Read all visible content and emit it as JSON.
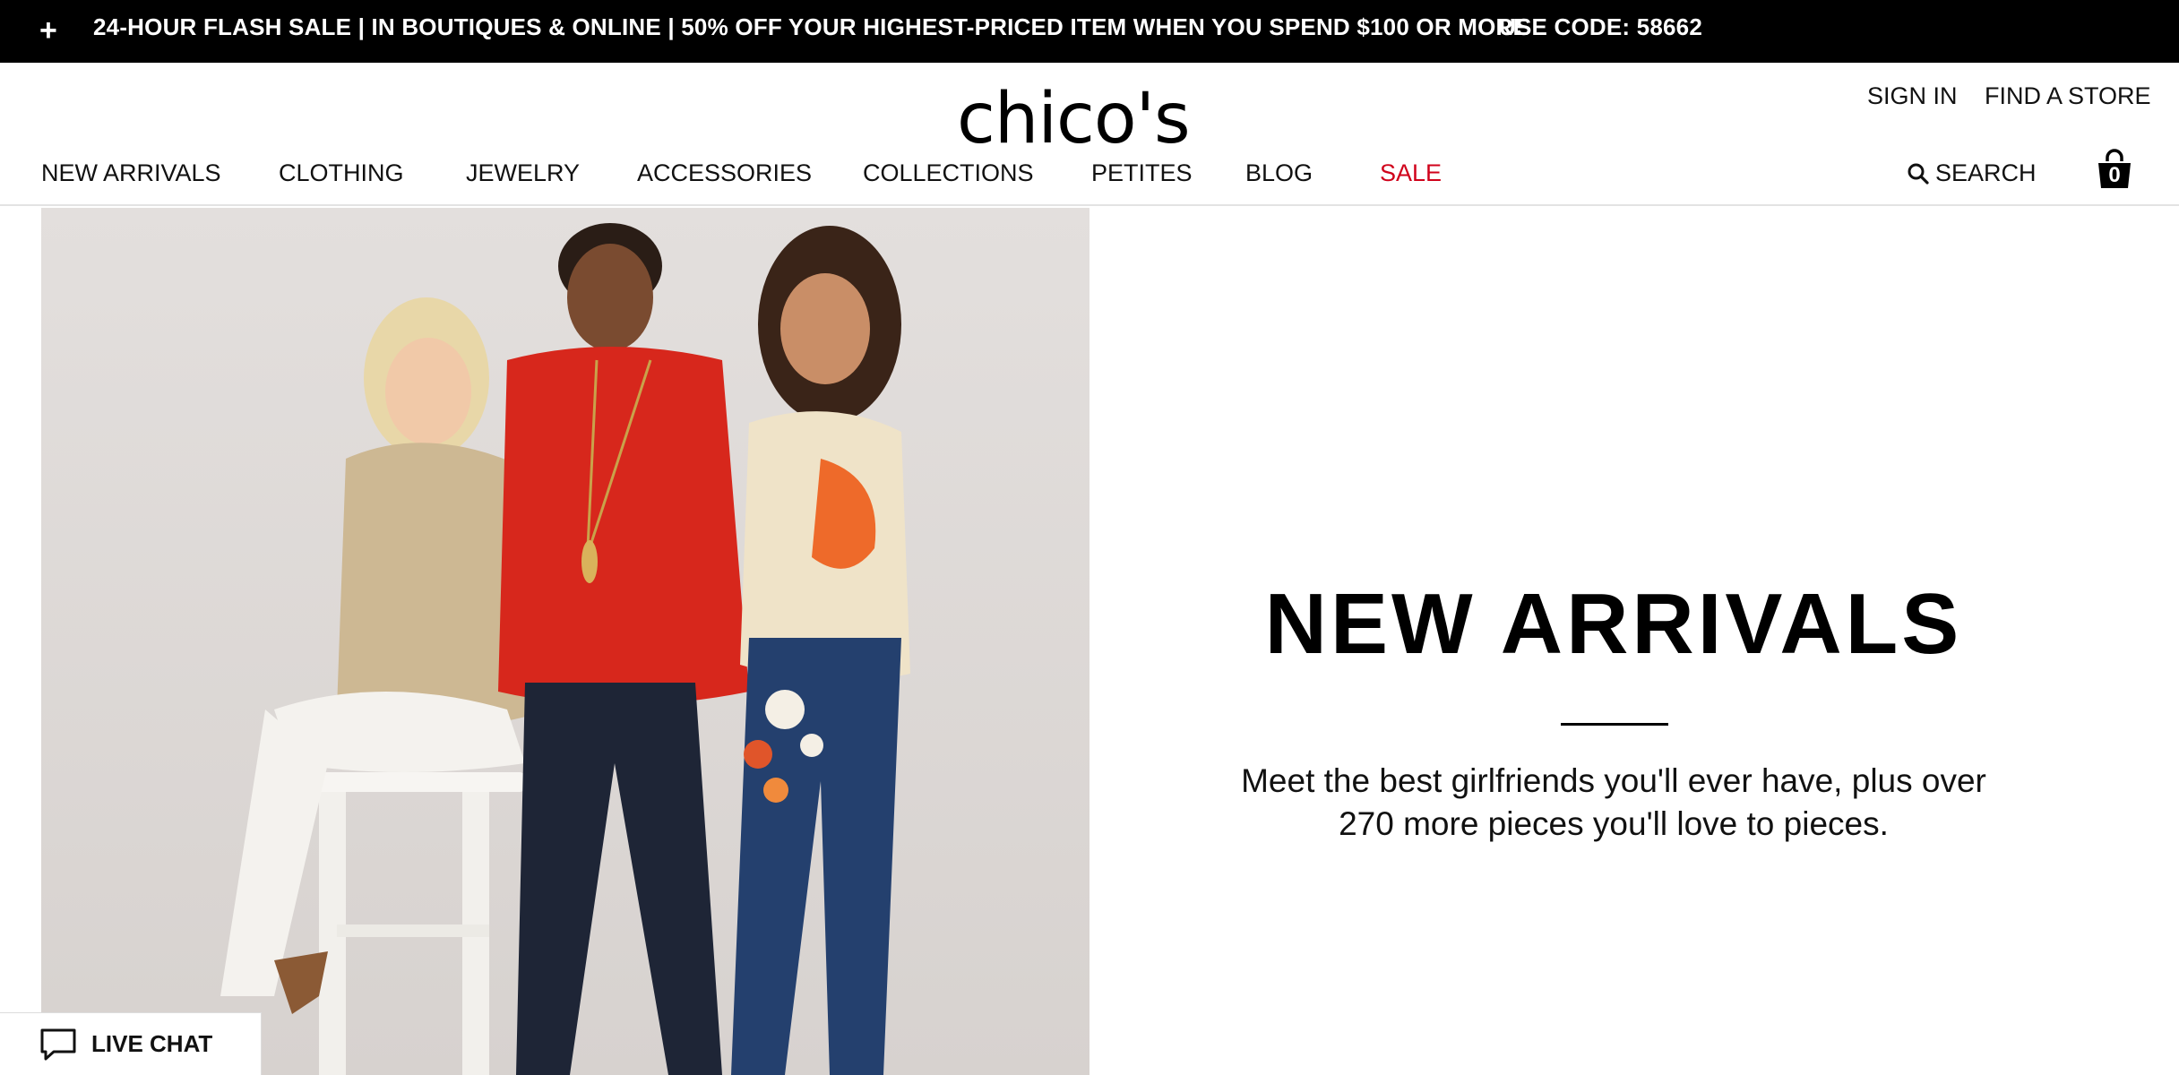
{
  "promo": {
    "plus": "+",
    "text": "24-HOUR FLASH SALE | IN BOUTIQUES & ONLINE | 50% OFF YOUR HIGHEST-PRICED ITEM WHEN YOU SPEND $100 OR MORE",
    "code": "USE CODE: 58662"
  },
  "header": {
    "logo": "chico's",
    "sign_in": "SIGN IN",
    "find_store": "FIND A STORE",
    "search_label": "SEARCH",
    "bag_count": "0"
  },
  "nav": {
    "items": [
      {
        "label": "NEW ARRIVALS"
      },
      {
        "label": "CLOTHING"
      },
      {
        "label": "JEWELRY"
      },
      {
        "label": "ACCESSORIES"
      },
      {
        "label": "COLLECTIONS"
      },
      {
        "label": "PETITES"
      },
      {
        "label": "BLOG"
      },
      {
        "label": "SALE"
      }
    ]
  },
  "hero": {
    "title": "NEW ARRIVALS",
    "description": "Meet the best girlfriends you'll ever have, plus over 270 more pieces you'll love to pieces."
  },
  "live_chat": {
    "label": "LIVE CHAT"
  },
  "colors": {
    "sale": "#d0021b",
    "promo_bg": "#000000",
    "hero_bg": "#dcd8d6"
  },
  "icons": [
    "plus-icon",
    "search-icon",
    "shopping-bag-icon",
    "chat-bubble-icon"
  ]
}
